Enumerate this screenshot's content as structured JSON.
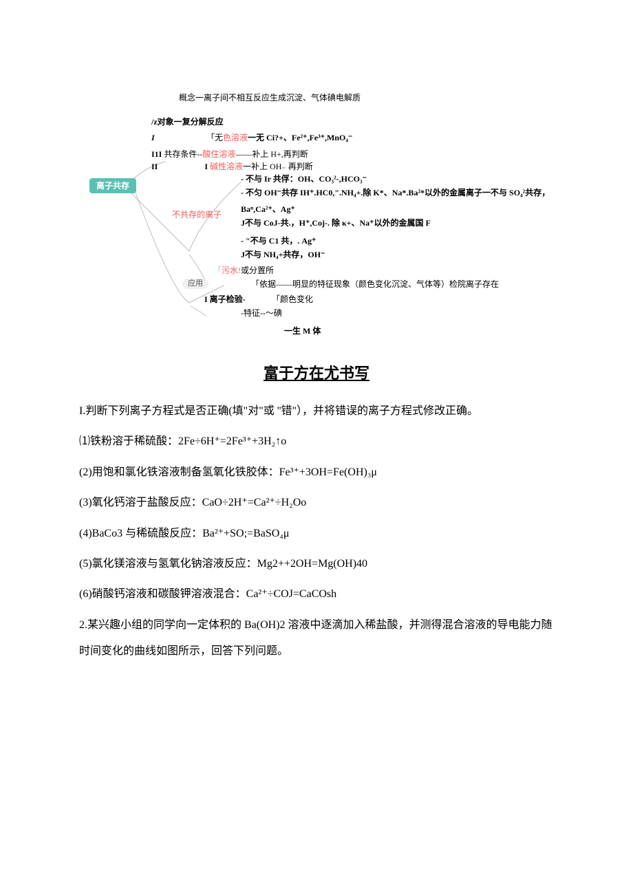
{
  "diagram": {
    "tagLabel": "离子共存",
    "concept": "概念一离子间不相互反应生成沉淀、气体碘电解质",
    "object": "/z对象一复分解反应",
    "i": "I",
    "colorLine": {
      "pre": "「无",
      "red": "色溶液",
      "post": "一无 Ci?+、Fe²⁺,Fe³⁺,MnO₄⁻"
    },
    "condLine": {
      "pre": "I1I",
      "post1": " 共存条件--",
      "red": "酸住溶液",
      "post2": "——补上 H+,再判断"
    },
    "condLine2": {
      "pre": "II",
      "mid": "I ",
      "red": "碱性溶液",
      "post": "一补上 OH₋ 再判断"
    },
    "notWith": [
      "-    不与 Ir 共俘：OH、CO₃²-,HCO₃⁻",
      "-    不匀 OH⁻共存 IH⁺.HC0,\".NH₄+.除 K*、Na*.Ba²*以外的金属离子一不与 SO₄²共存，",
      "Baⁿ,Ca²⁺、Ag⁺",
      "J不与 CoJ-共.，H⁺,Coj-. 除 κ+、Na⁺以外的金属国 F",
      "-   \"不与 C1 共，. Ag⁺",
      "J不与 NH₄+共存，OH⁻"
    ],
    "notCoexistLabel": "不共存的离子",
    "sewage": {
      "red": "污水!",
      "post": "或分置所"
    },
    "basis": "「依据——明显的特征现象（颜色变化沉淀、气体等）检院离子存在",
    "ionDetect": "I 离子检验-",
    "feature": "-特征--～碘",
    "colorChange": "「颜色变化",
    "gas": "一生 M 体",
    "appLabel": "应用"
  },
  "section_title": "富于方在尤书写",
  "q1_intro": "I.判断下列离子方程式是否正确(填\"对\"或 ''错\"），并将错误的离子方程式修改正确。",
  "q1_items": [
    "⑴铁粉溶于稀硫酸：2Fe÷6H⁺=2Fe³⁺+3H₂↑o",
    "(2)用饱和氯化铁溶液制备氢氧化铁胶体：Fe³⁺+3OH=Fe(OH)₃μ",
    "(3)氧化钙溶于盐酸反应：CaO÷2H⁺=Ca²⁺÷H₂Oo",
    "(4)BaCo3 与稀硫酸反应：Ba²⁺+SO;=BaSO₄μ",
    "(5)氯化镁溶液与氢氧化钠溶液反应：Mg2++2OH=Mg(OH)40",
    "(6)硝酸钙溶液和碳酸钾溶液混合：Ca²⁺÷COJ=CaCOsh"
  ],
  "q2": "2.某兴趣小组的同学向一定体积的 Ba(OH)2 溶液中逐滴加入稀盐酸，并测得混合溶液的导电能力随时间变化的曲线如图所示，回答下列问题。"
}
